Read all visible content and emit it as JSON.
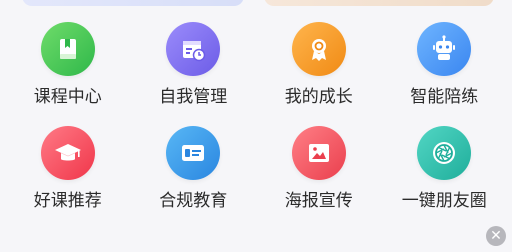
{
  "menu": {
    "items": [
      {
        "label": "课程中心",
        "icon": "book-icon",
        "color_from": "#6fdc6a",
        "color_to": "#2fb84a"
      },
      {
        "label": "自我管理",
        "icon": "calendar-clock-icon",
        "color_from": "#9b8cfb",
        "color_to": "#6c5ce7"
      },
      {
        "label": "我的成长",
        "icon": "award-badge-icon",
        "color_from": "#ffb54d",
        "color_to": "#f08a14"
      },
      {
        "label": "智能陪练",
        "icon": "robot-icon",
        "color_from": "#6fb5ff",
        "color_to": "#3a86f0"
      },
      {
        "label": "好课推荐",
        "icon": "graduation-cap-icon",
        "color_from": "#ff7a86",
        "color_to": "#f0364a"
      },
      {
        "label": "合规教育",
        "icon": "id-card-icon",
        "color_from": "#58b7f5",
        "color_to": "#2a86e0"
      },
      {
        "label": "海报宣传",
        "icon": "image-icon",
        "color_from": "#ff7f86",
        "color_to": "#ea3f4d"
      },
      {
        "label": "一键朋友圈",
        "icon": "camera-aperture-icon",
        "color_from": "#52d6c4",
        "color_to": "#1fae9b"
      }
    ]
  },
  "close": {
    "glyph": "✕"
  }
}
